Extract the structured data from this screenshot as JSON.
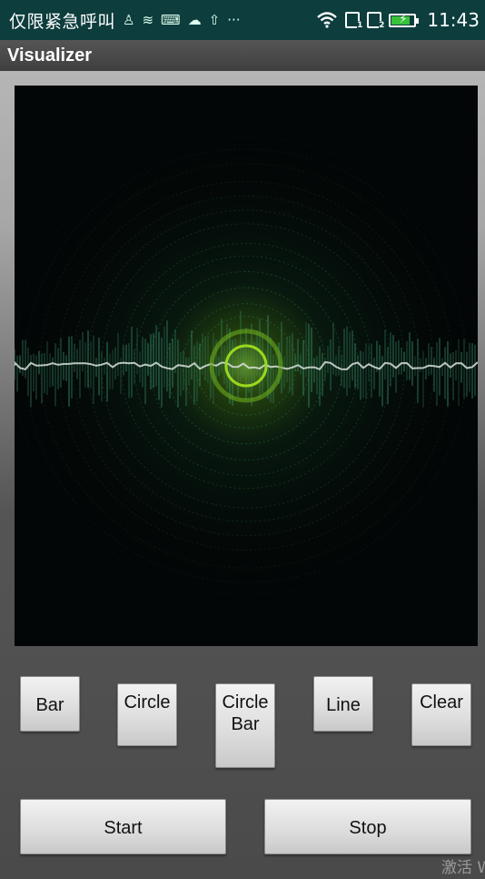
{
  "status_bar": {
    "carrier": "仅限紧急呼叫",
    "time": "11:43",
    "battery_level": 0.85,
    "icons": [
      "sim-person-icon",
      "wifi-calling-icon",
      "keyboard-icon",
      "cloud-icon",
      "upload-icon",
      "more-icon",
      "wifi-icon",
      "sim1-icon",
      "sim2-icon",
      "battery-icon"
    ],
    "more_glyph": "···"
  },
  "app": {
    "title": "Visualizer"
  },
  "visualizer": {
    "background": "#030606",
    "accent": "#9ad81e",
    "wave_color": "#d8e0dc"
  },
  "buttons": {
    "bar": "Bar",
    "circle": "Circle",
    "circle_bar": "CircleBar",
    "line": "Line",
    "clear": "Clear",
    "start": "Start",
    "stop": "Stop"
  },
  "watermark": "激活 Windows"
}
